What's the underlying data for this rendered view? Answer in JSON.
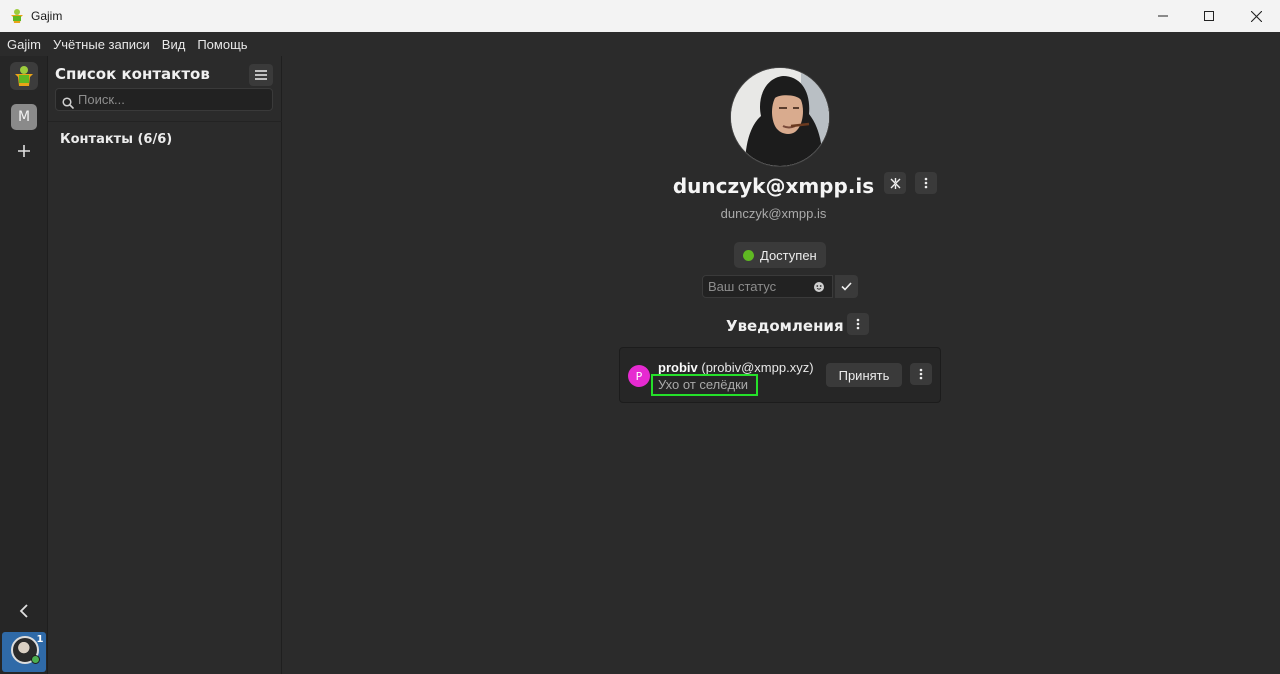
{
  "window": {
    "title": "Gajim",
    "controls": [
      "minimize",
      "maximize",
      "close"
    ]
  },
  "menubar": {
    "items": [
      "Gajim",
      "Учётные записи",
      "Вид",
      "Помощь"
    ]
  },
  "workspaces": {
    "items": [
      {
        "letter": "M"
      }
    ],
    "account_badge": "1"
  },
  "contacts_panel": {
    "title": "Список контактов",
    "search_placeholder": "Поиск...",
    "group_label": "Контакты (6/6)"
  },
  "profile": {
    "jid": "dunczyk@xmpp.is",
    "jid_secondary": "dunczyk@xmpp.is",
    "status_label": "Доступен",
    "status_color": "#5fb922",
    "status_message_placeholder": "Ваш статус"
  },
  "notifications": {
    "title": "Уведомления",
    "items": [
      {
        "avatar_letter": "P",
        "avatar_color": "#e62ad1",
        "name": "probiv",
        "address": "(probiv@xmpp.xyz)",
        "message": "Ухо от селёдки",
        "accept_label": "Принять"
      }
    ]
  }
}
